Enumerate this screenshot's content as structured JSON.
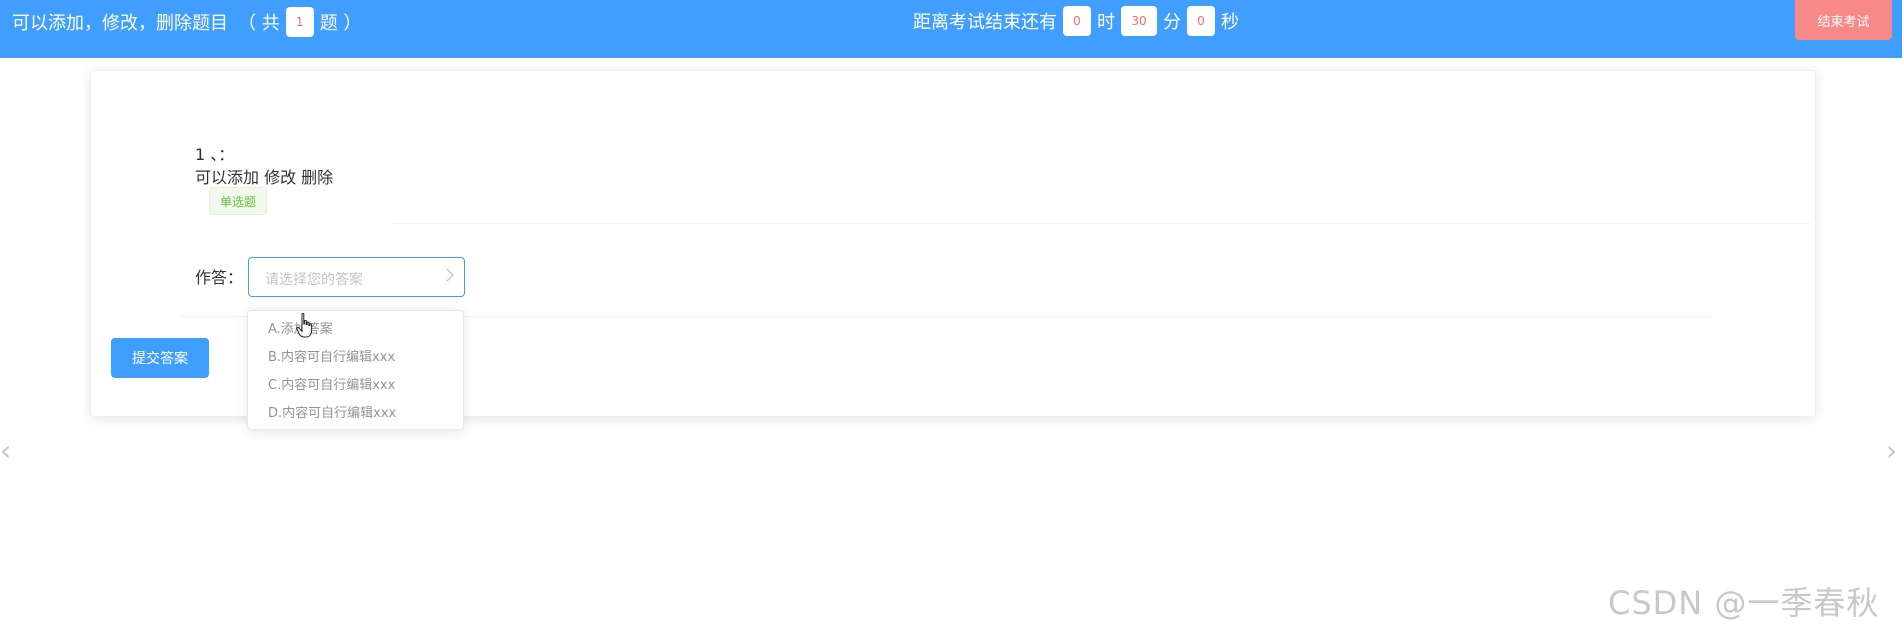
{
  "header": {
    "left_text": "可以添加，修改，删除题目",
    "count_prefix": "（ 共",
    "count_value": "1",
    "count_suffix": "题 ）",
    "timer_label": "距离考试结束还有",
    "hours": "0",
    "hours_unit": "时",
    "minutes": "30",
    "minutes_unit": "分",
    "seconds": "0",
    "seconds_unit": "秒",
    "end_exam_label": "结束考试"
  },
  "question": {
    "number": "1 、：",
    "text": "可以添加 修改 删除",
    "type_tag": "单选题",
    "answer_label": "作答：",
    "answer_placeholder": "请选择您的答案",
    "options": [
      "A.添加答案",
      "B.内容可自行编辑xxx",
      "C.内容可自行编辑xxx",
      "D.内容可自行编辑xxx"
    ],
    "submit_label": "提交答案"
  },
  "carousel": {
    "prev_glyph": "‹",
    "next_glyph": "›"
  },
  "watermark": "CSDN @一季春秋",
  "colors": {
    "primary": "#409eff",
    "danger": "#f78989",
    "countdown_text": "#f56c6c",
    "tag_success": "#67c23a"
  },
  "icons": {
    "select_arrow": "chevron-right-icon",
    "cursor": "hand-pointer-icon"
  }
}
